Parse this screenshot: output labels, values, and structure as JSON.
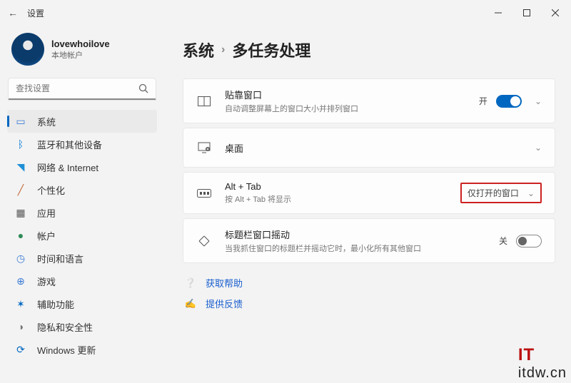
{
  "titlebar": {
    "title": "设置"
  },
  "profile": {
    "name": "lovewhoilove",
    "sub": "本地帐户"
  },
  "search": {
    "placeholder": "查找设置"
  },
  "nav": [
    {
      "label": "系统",
      "icon": "system",
      "active": true
    },
    {
      "label": "蓝牙和其他设备",
      "icon": "bluetooth"
    },
    {
      "label": "网络 & Internet",
      "icon": "wifi"
    },
    {
      "label": "个性化",
      "icon": "brush"
    },
    {
      "label": "应用",
      "icon": "apps"
    },
    {
      "label": "帐户",
      "icon": "account"
    },
    {
      "label": "时间和语言",
      "icon": "time"
    },
    {
      "label": "游戏",
      "icon": "game"
    },
    {
      "label": "辅助功能",
      "icon": "access"
    },
    {
      "label": "隐私和安全性",
      "icon": "privacy"
    },
    {
      "label": "Windows 更新",
      "icon": "update"
    }
  ],
  "breadcrumb": {
    "parent": "系统",
    "current": "多任务处理"
  },
  "cards": {
    "snap": {
      "title": "贴靠窗口",
      "sub": "自动调整屏幕上的窗口大小并排列窗口",
      "state": "开"
    },
    "desktops": {
      "title": "桌面"
    },
    "alttab": {
      "title": "Alt + Tab",
      "sub": "按 Alt + Tab 将显示",
      "value": "仅打开的窗口"
    },
    "shake": {
      "title": "标题栏窗口摇动",
      "sub": "当我抓住窗口的标题栏并摇动它时，最小化所有其他窗口",
      "state": "关"
    }
  },
  "links": {
    "help": "获取帮助",
    "feedback": "提供反馈"
  },
  "watermark": {
    "brand": "IT",
    "text": "itdw.cn"
  }
}
